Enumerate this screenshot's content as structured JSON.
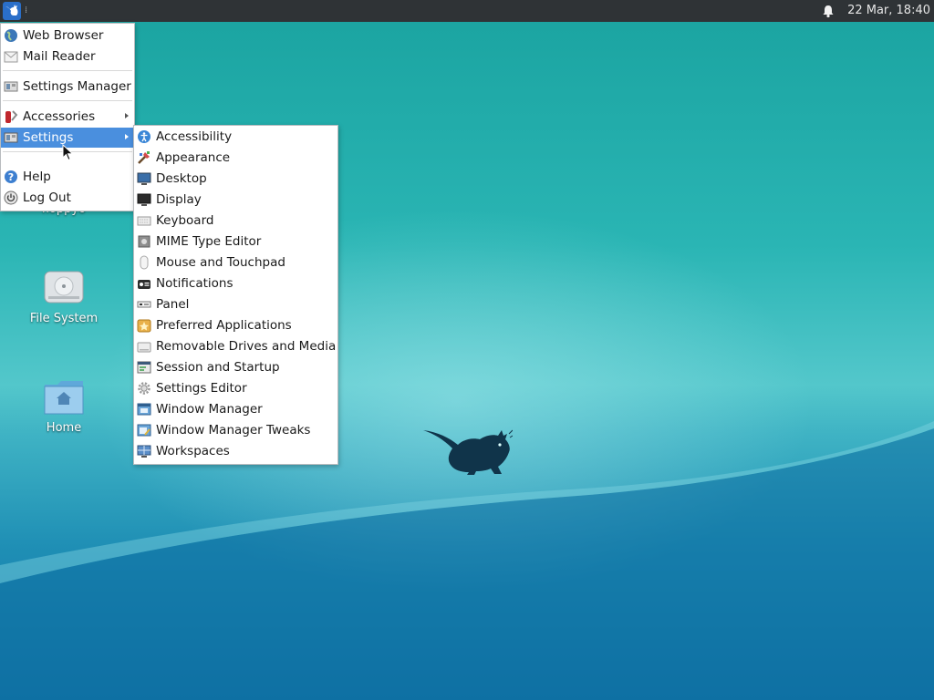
{
  "panel": {
    "clock": "22 Mar, 18:40",
    "menu_button_icon": "xfce-mouse-icon",
    "notifications_icon": "bell-icon"
  },
  "desktop": {
    "icons": [
      {
        "label": "floppy0",
        "icon": "floppy-icon"
      },
      {
        "label": "File System",
        "icon": "hard-drive-icon"
      },
      {
        "label": "Home",
        "icon": "home-folder-icon"
      }
    ]
  },
  "main_menu": {
    "items": [
      {
        "label": "Web Browser",
        "icon": "globe-icon"
      },
      {
        "label": "Mail Reader",
        "icon": "mail-icon"
      },
      {
        "label": "Settings Manager",
        "icon": "settings-manager-icon"
      },
      {
        "label": "Accessories",
        "icon": "accessories-icon",
        "submenu": true
      },
      {
        "label": "Settings",
        "icon": "settings-icon",
        "submenu": true,
        "active": true
      },
      {
        "label": "Help",
        "icon": "help-icon"
      },
      {
        "label": "Log Out",
        "icon": "power-icon"
      }
    ]
  },
  "settings_menu": {
    "items": [
      {
        "label": "Accessibility",
        "icon": "accessibility-icon"
      },
      {
        "label": "Appearance",
        "icon": "appearance-icon"
      },
      {
        "label": "Desktop",
        "icon": "desktop-icon"
      },
      {
        "label": "Display",
        "icon": "display-icon"
      },
      {
        "label": "Keyboard",
        "icon": "keyboard-icon"
      },
      {
        "label": "MIME Type Editor",
        "icon": "mime-icon"
      },
      {
        "label": "Mouse and Touchpad",
        "icon": "mouse-icon"
      },
      {
        "label": "Notifications",
        "icon": "notifications-icon"
      },
      {
        "label": "Panel",
        "icon": "panel-icon"
      },
      {
        "label": "Preferred Applications",
        "icon": "preferred-apps-icon"
      },
      {
        "label": "Removable Drives and Media",
        "icon": "removable-drive-icon"
      },
      {
        "label": "Session and Startup",
        "icon": "session-icon"
      },
      {
        "label": "Settings Editor",
        "icon": "gear-icon"
      },
      {
        "label": "Window Manager",
        "icon": "window-manager-icon"
      },
      {
        "label": "Window Manager Tweaks",
        "icon": "wm-tweaks-icon"
      },
      {
        "label": "Workspaces",
        "icon": "workspaces-icon"
      }
    ]
  },
  "colors": {
    "highlight": "#4a8fde",
    "panel": "#2f3336"
  }
}
